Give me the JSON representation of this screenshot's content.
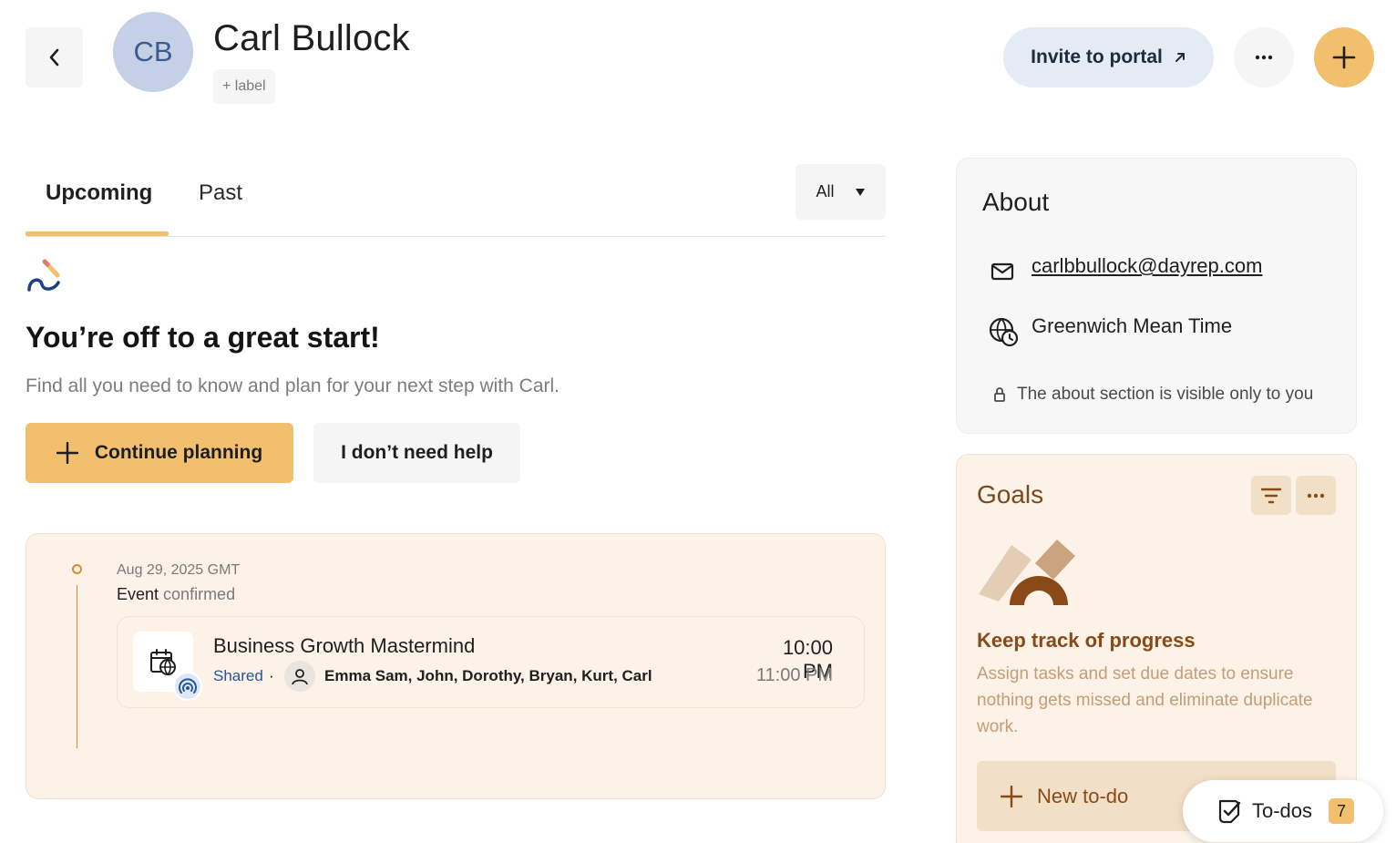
{
  "header": {
    "back_label": "Back",
    "avatar_initials": "CB",
    "client_name": "Carl Bullock",
    "add_label": "+ label",
    "invite_label": "Invite to portal",
    "more_label": "More",
    "add_label_button": "Add"
  },
  "tabs": {
    "items": [
      {
        "label": "Upcoming",
        "active": true
      },
      {
        "label": "Past",
        "active": false
      }
    ],
    "filter_value": "All"
  },
  "empty_state": {
    "headline": "You’re off to a great start!",
    "subtext": "Find all you need to know and plan for your next step with Carl.",
    "primary_label": "Continue planning",
    "secondary_label": "I don’t need help"
  },
  "timeline": {
    "date": "Aug 29, 2025 GMT",
    "status_prefix": "Event",
    "status_word": "confirmed",
    "event": {
      "title": "Business Growth Mastermind",
      "visibility": "Shared",
      "attendees": "Emma Sam, John, Dorothy, Bryan, Kurt, Carl",
      "start_time": "10:00 PM",
      "end_time": "11:00 PM"
    }
  },
  "about": {
    "title": "About",
    "email": "carlbbullock@dayrep.com",
    "timezone": "Greenwich Mean Time",
    "note": "The about section is visible only to you"
  },
  "goals": {
    "title": "Goals",
    "heading": "Keep track of progress",
    "description": "Assign tasks and set due dates to ensure nothing gets missed and eliminate duplicate work.",
    "new_todo_label": "New to-do"
  },
  "todos": {
    "label": "To-dos",
    "count": "7"
  },
  "colors": {
    "accent": "#f1bf6e",
    "goals_text": "#8a4a17",
    "link_blue": "#26539c"
  },
  "icons": [
    "chevron-left-icon",
    "ellipsis-icon",
    "plus-icon",
    "arrow-up-right-icon",
    "caret-down-icon",
    "squiggle-icon",
    "calendar-globe-icon",
    "broadcast-icon",
    "person-icon",
    "mail-icon",
    "globe-clock-icon",
    "lock-icon",
    "filter-icon",
    "todo-check-icon"
  ]
}
